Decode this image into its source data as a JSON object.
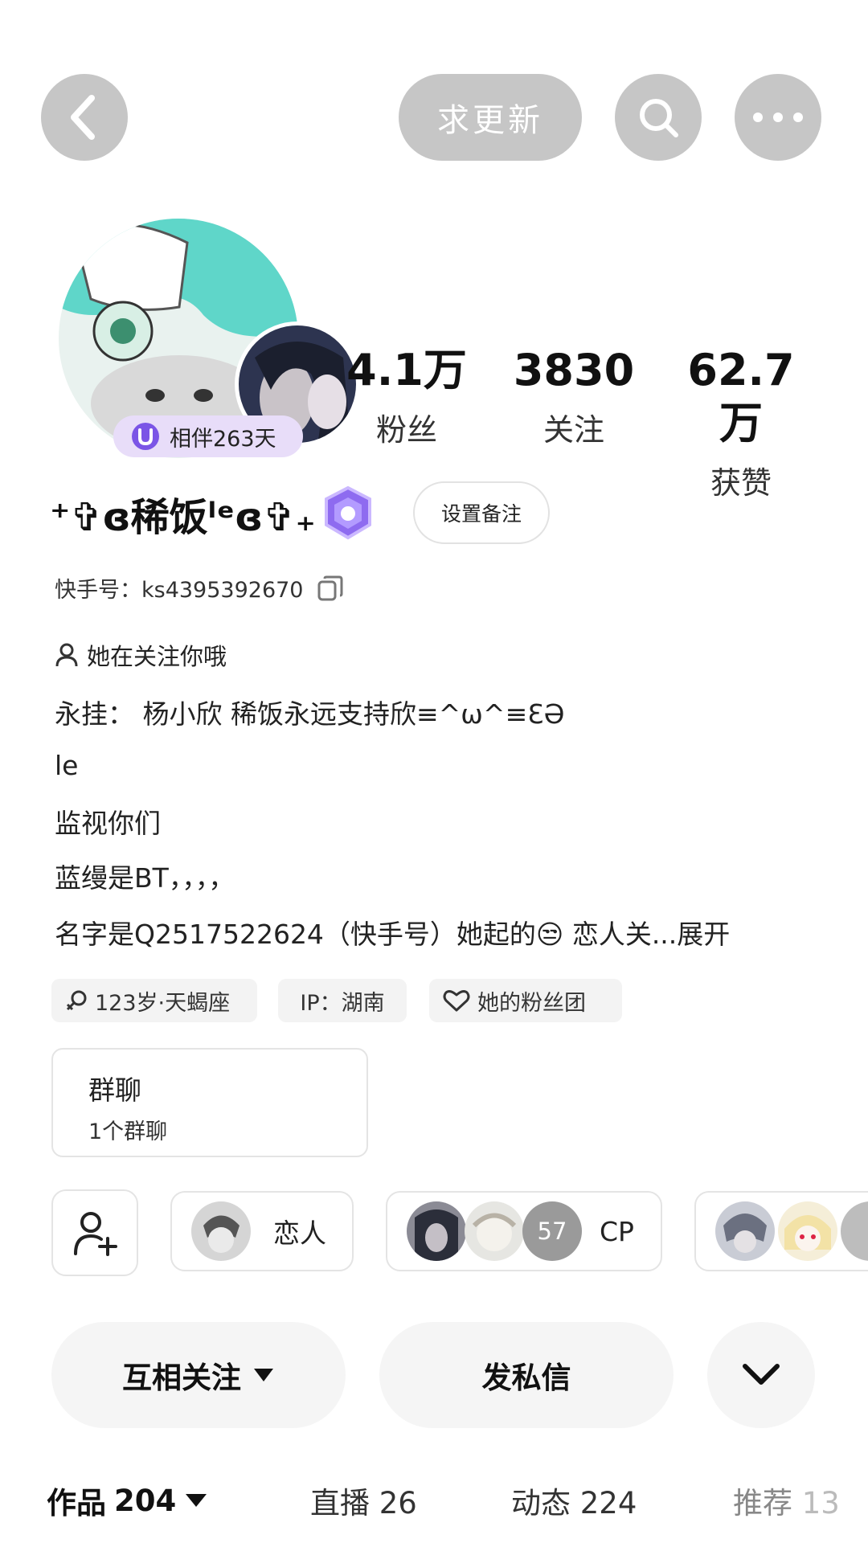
{
  "topbar": {
    "back_icon": "chevron-left-icon",
    "update_label": "求更新",
    "search_icon": "search-icon",
    "more_icon": "more-horizontal-icon"
  },
  "profile": {
    "companion_badge": "相伴263天",
    "stats": [
      {
        "value": "4.1万",
        "label": "粉丝"
      },
      {
        "value": "3830",
        "label": "关注"
      },
      {
        "value": "62.7万",
        "label": "获赞"
      }
    ],
    "username": "⁺✞ɞ稀饭ˡᵉɞ✞₊",
    "set_note_label": "设置备注",
    "kuaishou_id_label": "快手号：",
    "kuaishou_id": "ks4395392670",
    "follows_you": "她在关注你哦"
  },
  "bio": {
    "lines": [
      "永挂： 杨小欣 稀饭永远支持欣≡^ω^≡ƐƏ",
      "le",
      "监视你们",
      "蓝缦是BT，，，，",
      "名字是Q2517522624（快手号）她起的😒 恋人关...展开"
    ]
  },
  "tags": [
    {
      "icon": "gender-female-icon",
      "text": "123岁·天蝎座"
    },
    {
      "icon": "",
      "text": "IP：湖南"
    },
    {
      "icon": "heart-outline-icon",
      "text": "她的粉丝团"
    }
  ],
  "group": {
    "title": "群聊",
    "subtitle": "1个群聊"
  },
  "relations": {
    "add_icon": "add-user-icon",
    "lover_label": "恋人",
    "cp_count": "57",
    "cp_label": "CP"
  },
  "actions": {
    "follow_label": "互相关注",
    "message_label": "发私信",
    "expand_icon": "chevron-down-icon"
  },
  "tabs": [
    {
      "label": "作品",
      "count": "204"
    },
    {
      "label": "直播",
      "count": "26"
    },
    {
      "label": "动态",
      "count": "224"
    },
    {
      "label": "推荐",
      "count": "13"
    }
  ],
  "colors": {
    "button_gray": "#c6c6c6",
    "badge_purple": "#7b55e6",
    "badge_bg": "#e8ddf9"
  }
}
